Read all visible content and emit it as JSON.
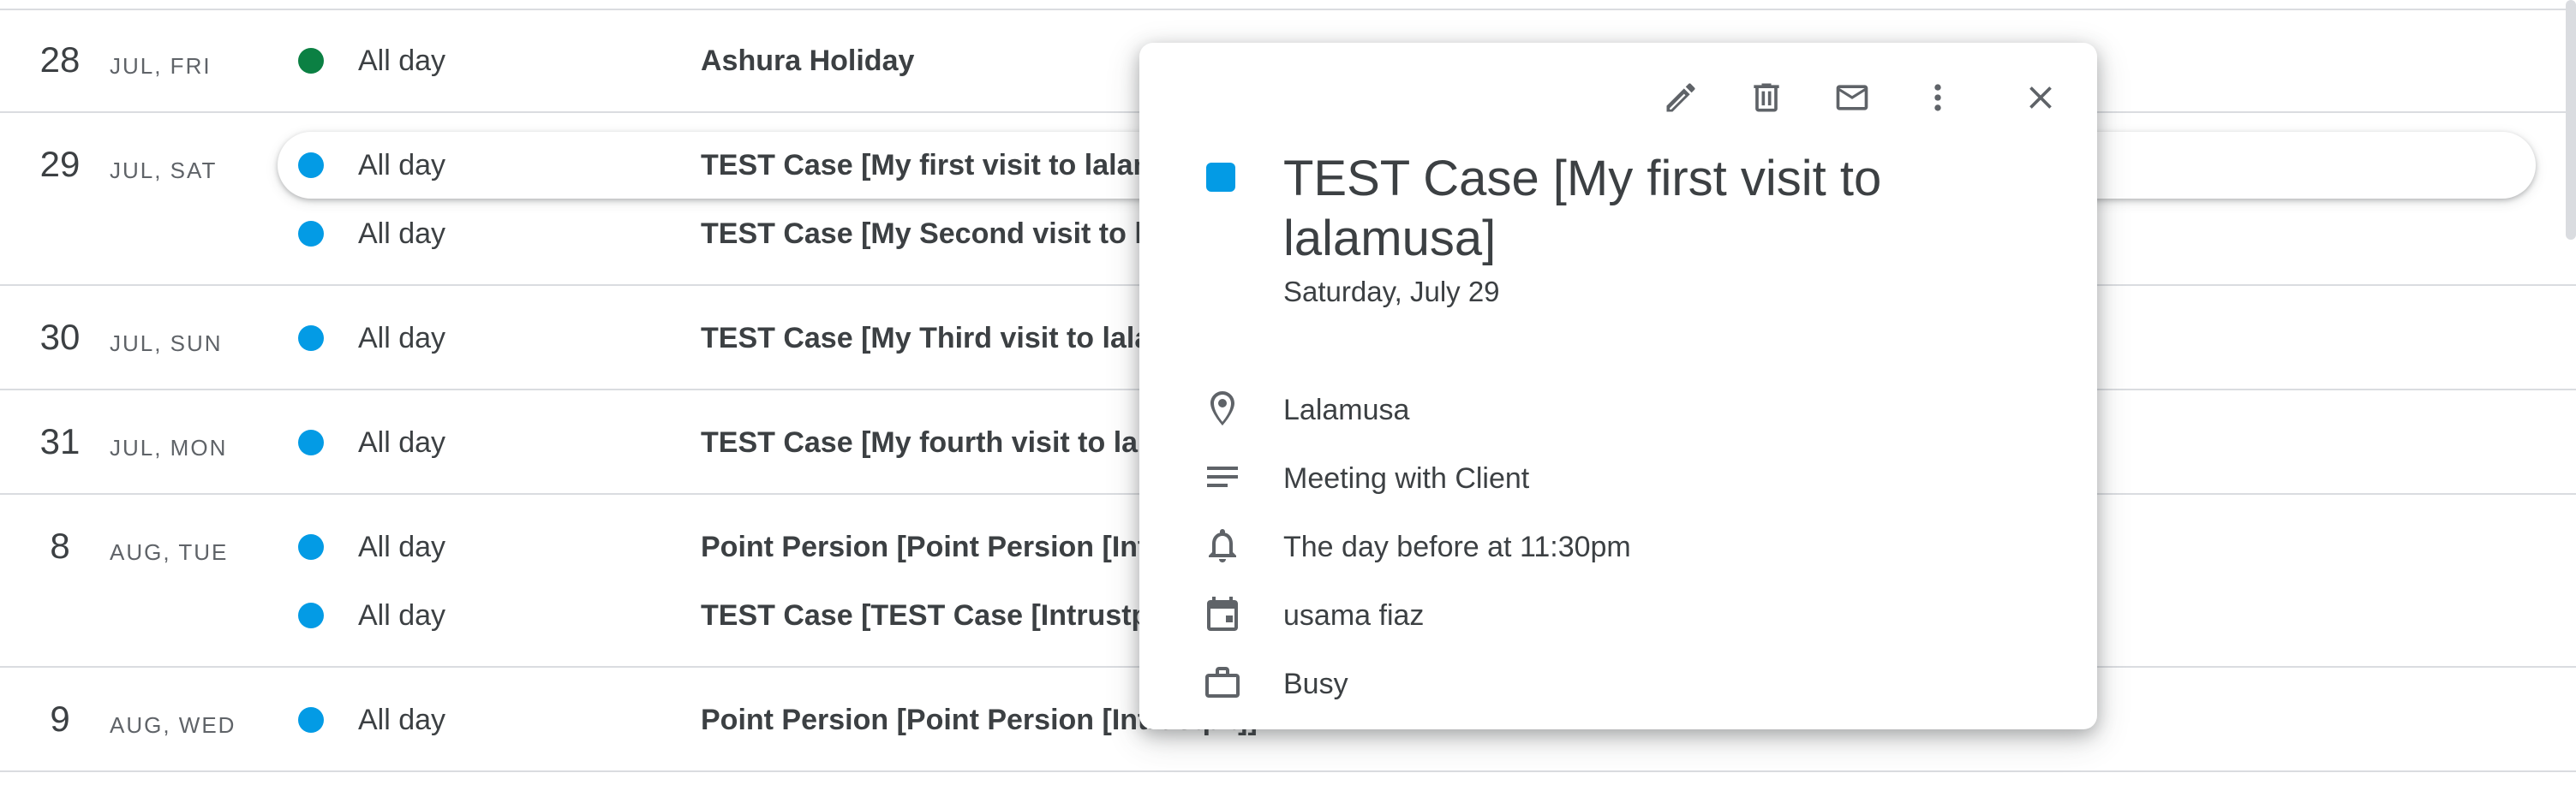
{
  "colors": {
    "holiday_green": "#0b8043",
    "event_blue": "#039be5"
  },
  "agenda": {
    "days": [
      {
        "num": "28",
        "label": "JUL, FRI",
        "events": [
          {
            "time": "All day",
            "title": "Ashura Holiday",
            "color": "holiday_green"
          }
        ]
      },
      {
        "num": "29",
        "label": "JUL, SAT",
        "events": [
          {
            "time": "All day",
            "title": "TEST Case [My first visit to lalamusa]",
            "color": "event_blue"
          },
          {
            "time": "All day",
            "title": "TEST Case [My Second visit to lalamusa]",
            "color": "event_blue"
          }
        ]
      },
      {
        "num": "30",
        "label": "JUL, SUN",
        "events": [
          {
            "time": "All day",
            "title": "TEST Case [My Third visit to lalamusa]",
            "color": "event_blue"
          }
        ]
      },
      {
        "num": "31",
        "label": "JUL, MON",
        "events": [
          {
            "time": "All day",
            "title": "TEST Case [My fourth visit to lalamusa]",
            "color": "event_blue"
          }
        ]
      },
      {
        "num": "8",
        "label": "AUG, TUE",
        "events": [
          {
            "time": "All day",
            "title": "Point Persion [Point Persion [Intrustpit]]",
            "color": "event_blue"
          },
          {
            "time": "All day",
            "title": "TEST Case [TEST Case [Intrustpit]]",
            "color": "event_blue"
          }
        ]
      },
      {
        "num": "9",
        "label": "AUG, WED",
        "events": [
          {
            "time": "All day",
            "title": "Point Persion [Point Persion [Intrustpit]]",
            "color": "event_blue"
          }
        ]
      }
    ]
  },
  "popup": {
    "toolbar": {
      "edit_icon": "pencil-icon",
      "delete_icon": "trash-icon",
      "email_icon": "mail-icon",
      "more_icon": "more-vert-icon",
      "close_icon": "close-icon"
    },
    "title": "TEST Case [My first visit to lalamusa]",
    "date": "Saturday, July 29",
    "details": {
      "location": "Lalamusa",
      "description": "Meeting with Client",
      "reminder": "The day before at 11:30pm",
      "calendar": "usama fiaz",
      "availability": "Busy"
    }
  }
}
